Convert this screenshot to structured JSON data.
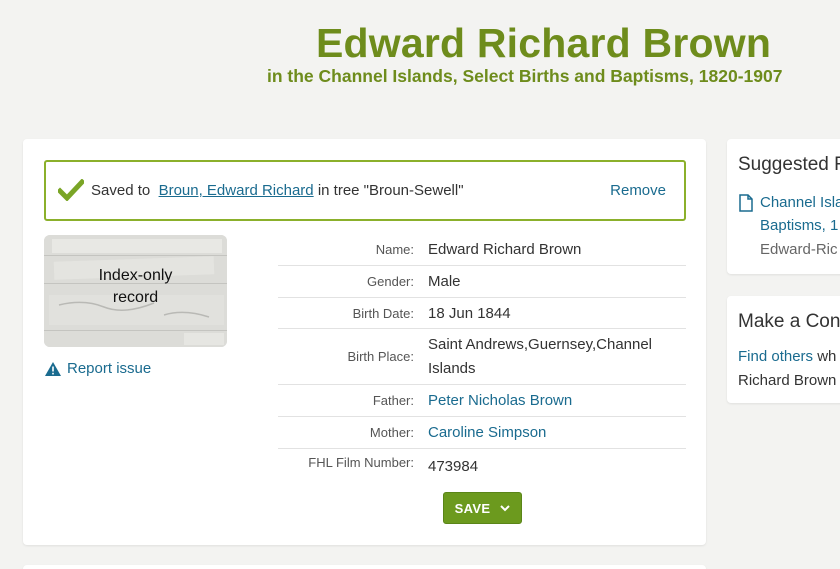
{
  "header": {
    "title": "Edward Richard Brown",
    "subtitle": "in the Channel Islands, Select Births and Baptisms, 1820-1907"
  },
  "saved": {
    "prefix": "Saved to",
    "person_link": "Broun, Edward Richard",
    "suffix": "in tree \"Broun-Sewell\"",
    "remove_label": "Remove",
    "accent_color": "#8bb02b"
  },
  "record_image": {
    "label_line1": "Index-only",
    "label_line2": "record"
  },
  "report_label": "Report issue",
  "fields": [
    {
      "label": "Name:",
      "value": "Edward Richard Brown",
      "link": false
    },
    {
      "label": "Gender:",
      "value": "Male",
      "link": false
    },
    {
      "label": "Birth Date:",
      "value": "18 Jun 1844",
      "link": false
    },
    {
      "label": "Birth Place:",
      "value": "Saint Andrews,Guernsey,Channel Islands",
      "link": false
    },
    {
      "label": "Father:",
      "value": "Peter Nicholas Brown",
      "link": true
    },
    {
      "label": "Mother:",
      "value": "Caroline Simpson",
      "link": true
    },
    {
      "label": "FHL Film Number:",
      "value": "473984",
      "link": false
    }
  ],
  "save_button": {
    "label": "SAVE",
    "icon": "chevron-down-icon"
  },
  "sidebar": {
    "suggested_heading": "Suggested R",
    "suggested_link_line1": "Channel Isla",
    "suggested_link_line2": "Baptisms, 1",
    "suggested_sub": "Edward-Ric",
    "connect_heading": "Make a Con",
    "find_others_link": "Find others",
    "find_others_rest": "wh",
    "connect_text_line2": "Richard Brown"
  }
}
